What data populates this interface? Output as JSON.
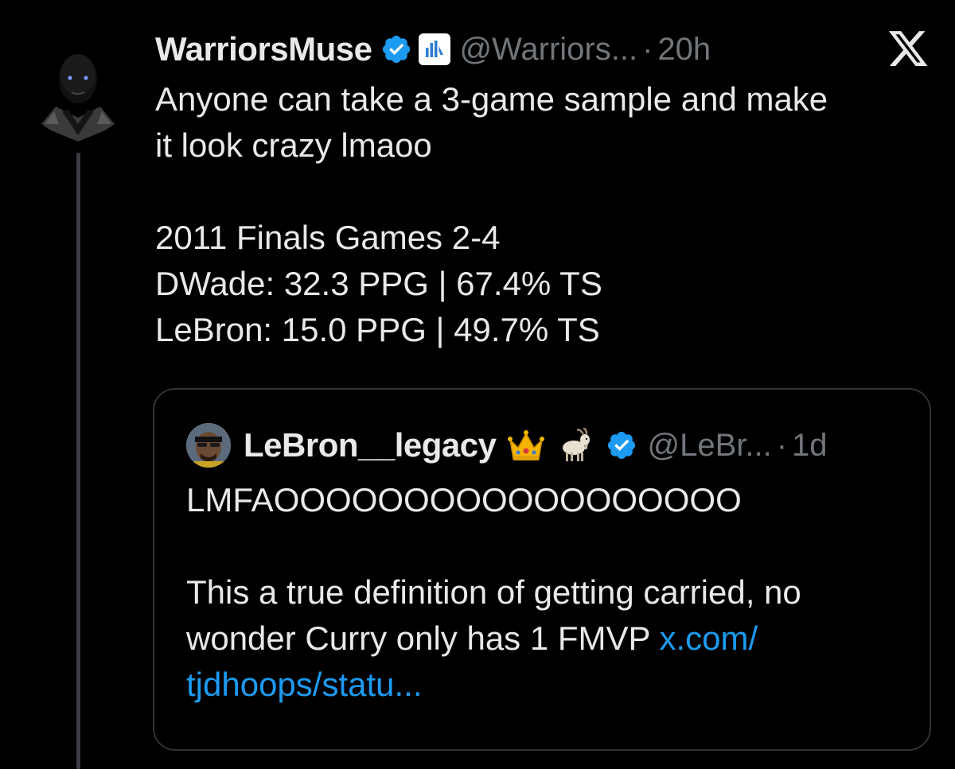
{
  "tweet": {
    "author_name": "WarriorsMuse",
    "handle": "@Warriors...",
    "separator": "·",
    "time": "20h",
    "lines": [
      "Anyone can take a 3-game sample and make",
      "it look crazy lmaoo",
      "",
      "2011 Finals Games 2-4",
      "DWade: 32.3 PPG | 67.4% TS",
      "LeBron: 15.0 PPG | 49.7% TS"
    ]
  },
  "quote": {
    "author_name": "LeBron__legacy",
    "handle": "@LeBr...",
    "separator": "·",
    "time": "1d",
    "line1": "LMFAOOOOOOOOOOOOOOOOOO",
    "line2": "This a true definition of getting carried, no",
    "line3_text": "wonder Curry only has 1 FMVP ",
    "line3_link": "x.com/",
    "line4_link": "tjdhoops/statu..."
  },
  "icons": {
    "verified": "verified-badge-icon",
    "affiliate": "affiliate-badge-icon",
    "x_logo": "x-logo-icon",
    "crown": "crown-emoji-icon",
    "goat": "goat-emoji-icon"
  },
  "colors": {
    "background": "#000000",
    "text": "#e7e9ea",
    "secondary": "#71767b",
    "verified": "#1d9bf0",
    "link": "#1d9bf0",
    "border": "#2f3336"
  }
}
